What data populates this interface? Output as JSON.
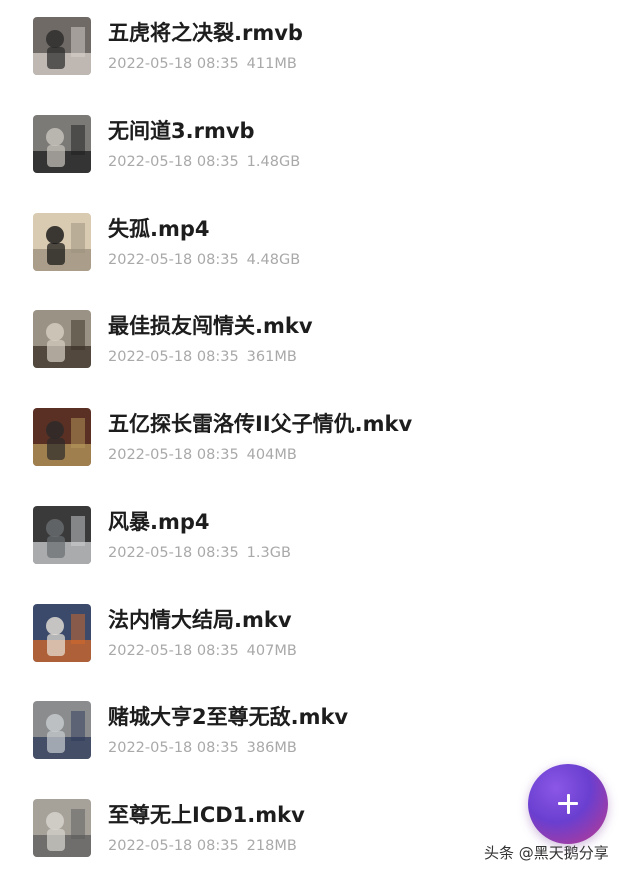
{
  "files": [
    {
      "name": "五虎将之决裂.rmvb",
      "date": "2022-05-18 08:35",
      "size": "411MB",
      "thumb_colors": [
        "#6f6a66",
        "#d8d2cc",
        "#2a2a2a"
      ]
    },
    {
      "name": "无间道3.rmvb",
      "date": "2022-05-18 08:35",
      "size": "1.48GB",
      "thumb_colors": [
        "#7b7a77",
        "#1e1e1e",
        "#c9c4bd"
      ]
    },
    {
      "name": "失孤.mp4",
      "date": "2022-05-18 08:35",
      "size": "4.48GB",
      "thumb_colors": [
        "#d9cbb2",
        "#9a8f7c",
        "#111111"
      ]
    },
    {
      "name": "最佳损友闯情关.mkv",
      "date": "2022-05-18 08:35",
      "size": "361MB",
      "thumb_colors": [
        "#9a9284",
        "#3a2f26",
        "#d7d0c3"
      ]
    },
    {
      "name": "五亿探长雷洛传II父子情仇.mkv",
      "date": "2022-05-18 08:35",
      "size": "404MB",
      "thumb_colors": [
        "#5a3024",
        "#b89a5c",
        "#2b2b2b"
      ]
    },
    {
      "name": "风暴.mp4",
      "date": "2022-05-18 08:35",
      "size": "1.3GB",
      "thumb_colors": [
        "#3a3a3a",
        "#cfd2d4",
        "#6a6e70"
      ]
    },
    {
      "name": "法内情大结局.mkv",
      "date": "2022-05-18 08:35",
      "size": "407MB",
      "thumb_colors": [
        "#3b4a6a",
        "#d66a2a",
        "#e8e2d8"
      ]
    },
    {
      "name": "赌城大亨2至尊无敌.mkv",
      "date": "2022-05-18 08:35",
      "size": "386MB",
      "thumb_colors": [
        "#8a8c8e",
        "#2e3a5a",
        "#c9cdd1"
      ]
    },
    {
      "name": "至尊无上ICD1.mkv",
      "date": "2022-05-18 08:35",
      "size": "218MB",
      "thumb_colors": [
        "#a6a29a",
        "#5c5c5c",
        "#d9d6d0"
      ]
    }
  ],
  "fab": {
    "icon": "plus-icon",
    "gradient": [
      "#8b57e6",
      "#c1398a"
    ]
  },
  "watermark": "头条 @黑天鹅分享"
}
